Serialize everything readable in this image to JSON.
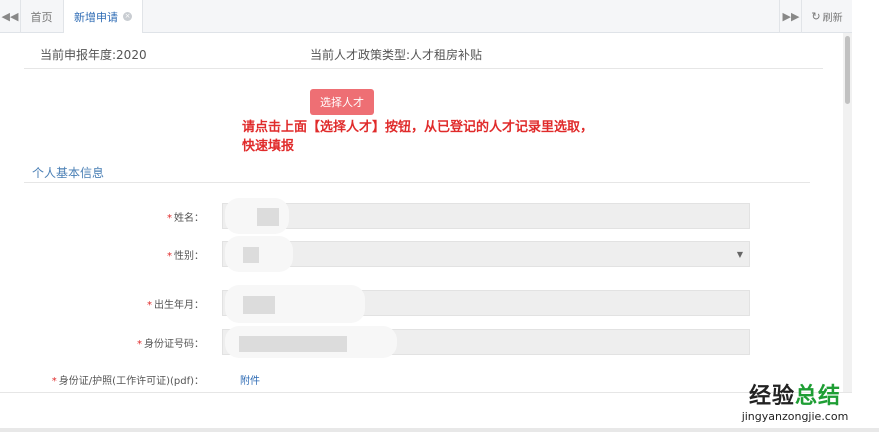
{
  "tabbar": {
    "nav_left_icon": "double-chevron-left-icon",
    "nav_left_glyph": "◀◀",
    "home_label": "首页",
    "active_tab_label": "新增申请",
    "close_glyph": "×",
    "nav_right_glyph": "▶▶",
    "refresh_glyph": "↻",
    "refresh_label": "刷新"
  },
  "info": {
    "year": "当前申报年度:2020",
    "policy_type": "当前人才政策类型:人才租房补贴"
  },
  "select_button": {
    "label": "选择人才"
  },
  "hint": {
    "line1": "请点击上面【选择人才】按钮，从已登记的人才记录里选取，",
    "line2": "快速填报"
  },
  "section": {
    "title": "个人基本信息"
  },
  "fields": {
    "required_mark": "*",
    "name_label": "姓名：",
    "gender_label": "性别：",
    "birth_label": "出生年月：",
    "id_label": "身份证号码：",
    "passport_label": "身份证/护照(工作许可证)(pdf)：",
    "attach_label": "附件",
    "select_caret": "▼"
  },
  "watermark": {
    "cn_main": "经验",
    "cn_sub": "总结",
    "url": "jingyanzongjie.com"
  },
  "colors": {
    "accent_blue": "#2f6cb5",
    "button_red": "#ee6f74",
    "hint_red": "#e02b2b",
    "section_blue": "#4a7fb5"
  }
}
